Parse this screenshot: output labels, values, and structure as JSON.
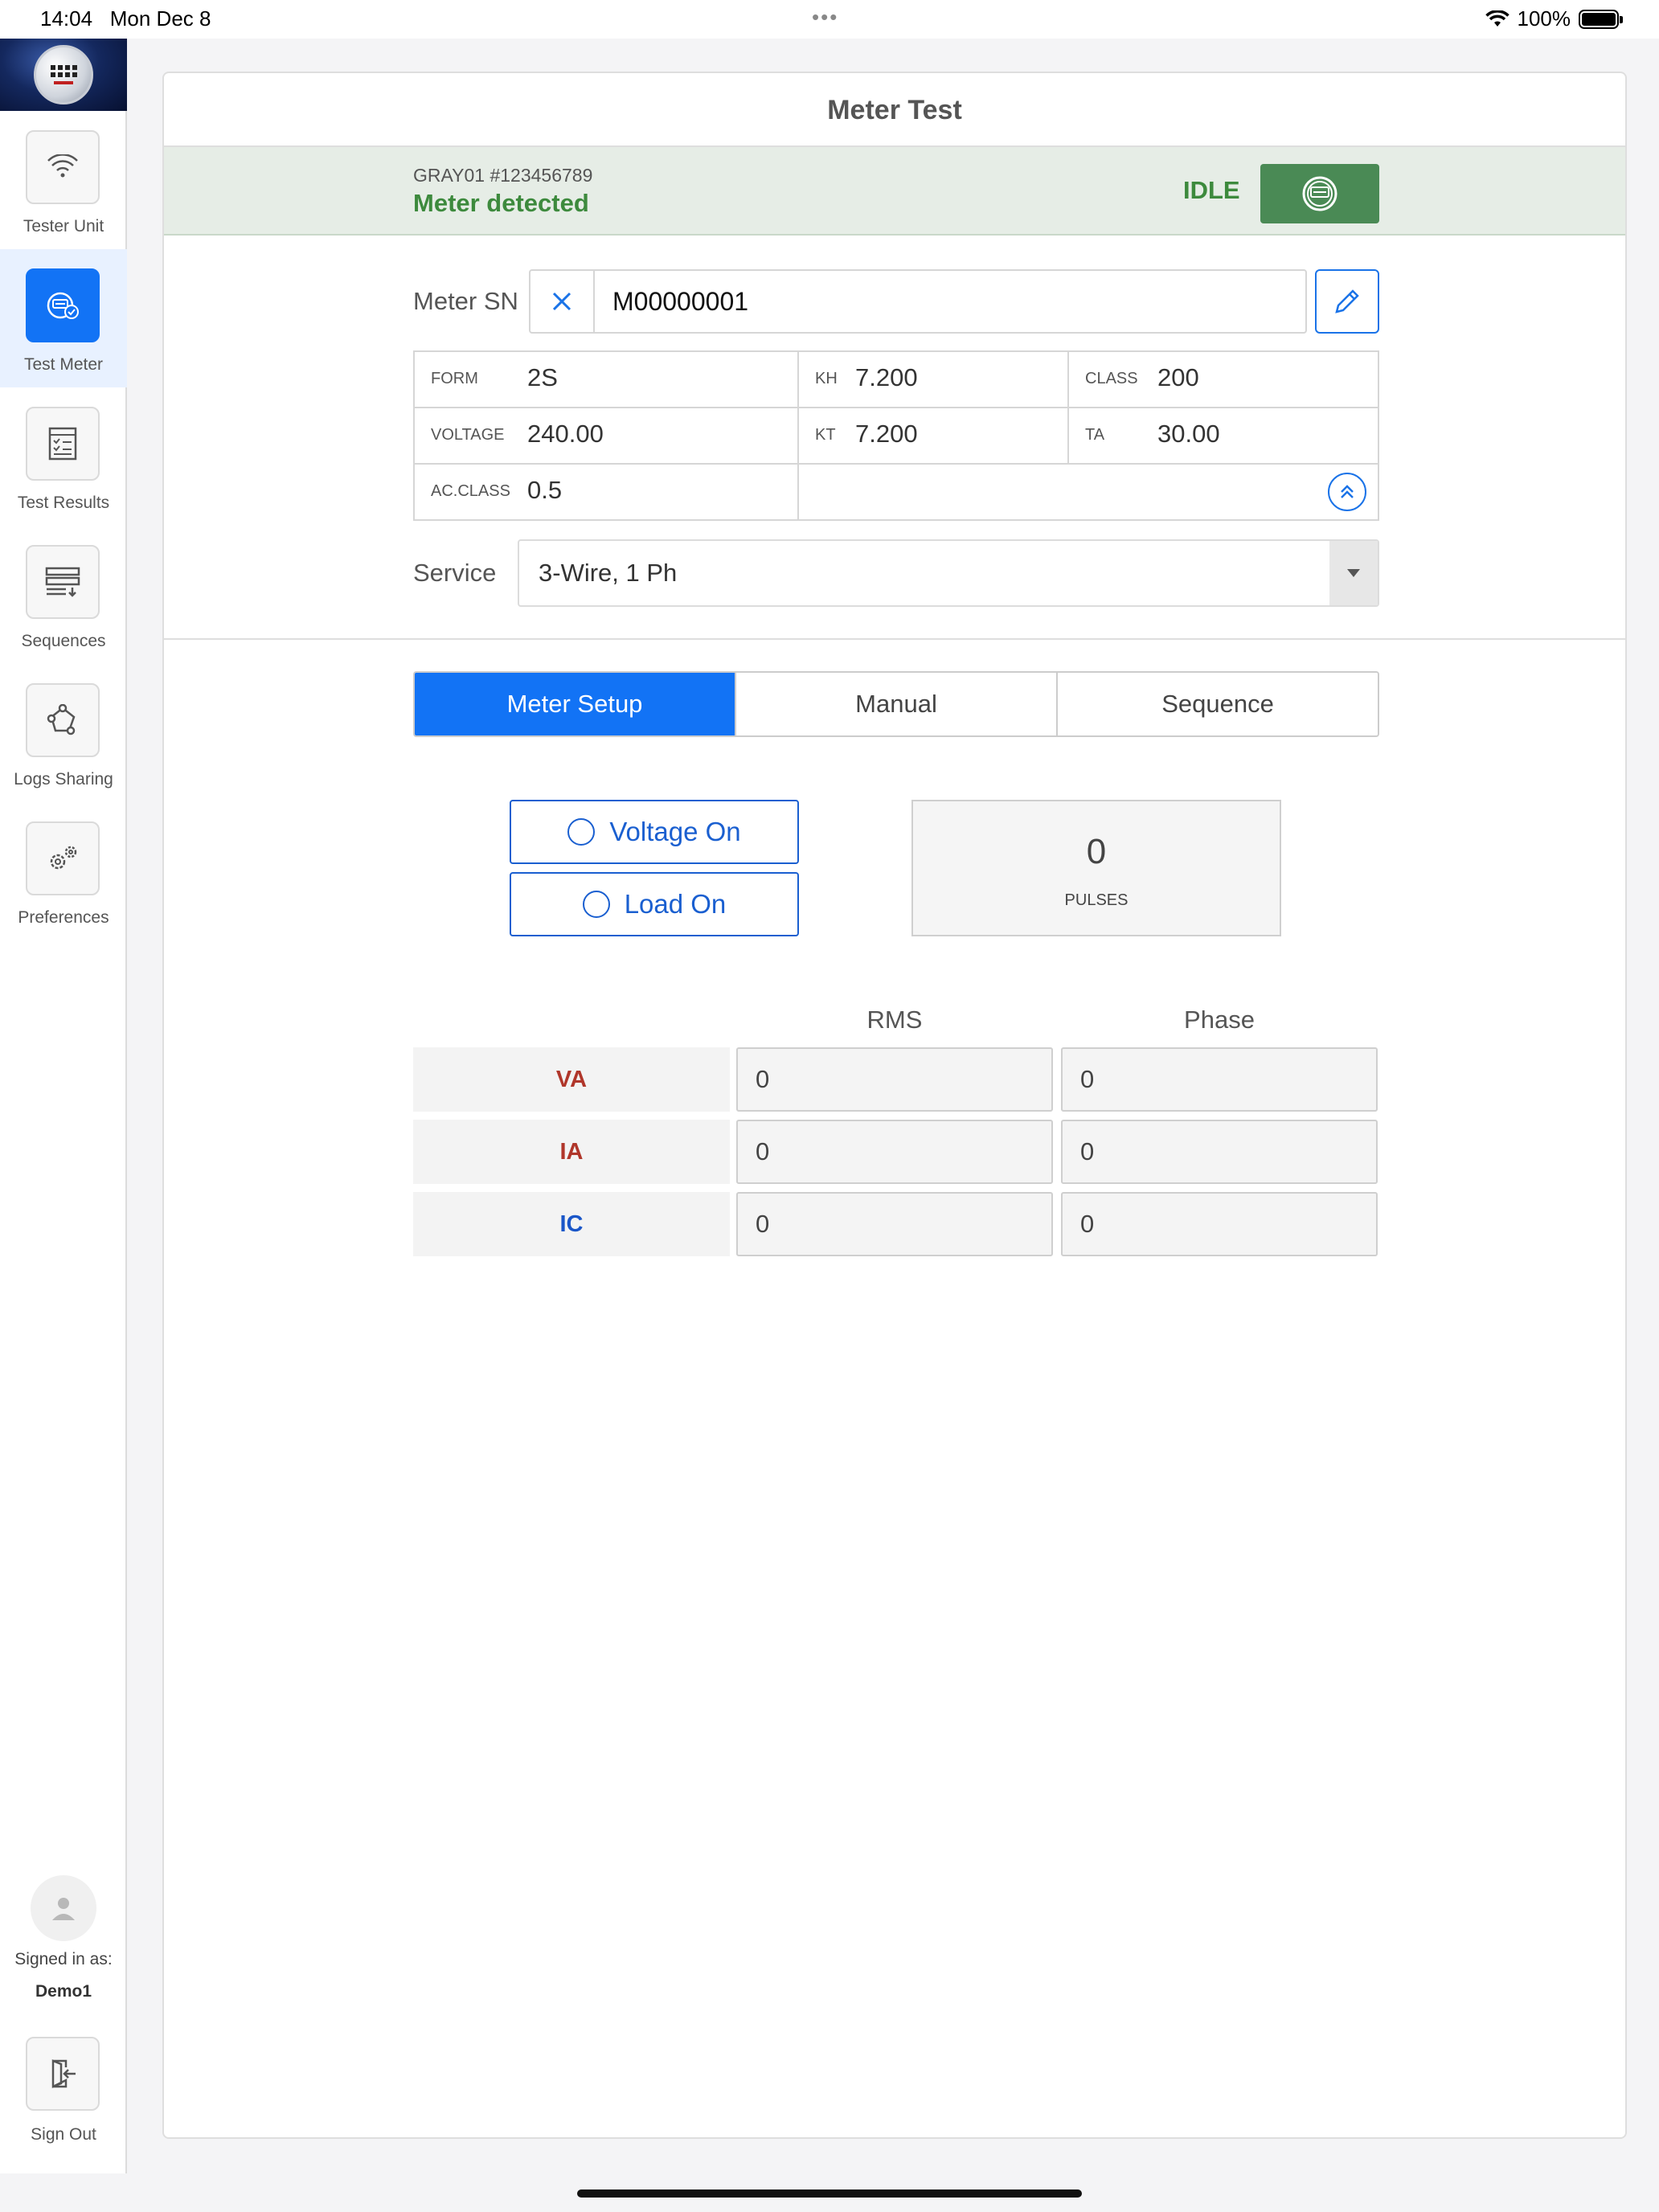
{
  "status_bar": {
    "time": "14:04",
    "date": "Mon Dec 8",
    "battery": "100%"
  },
  "sidebar": {
    "items": [
      {
        "label": "Tester Unit",
        "icon": "wifi-icon"
      },
      {
        "label": "Test Meter",
        "icon": "meter-check-icon",
        "active": true
      },
      {
        "label": "Test Results",
        "icon": "checklist-icon"
      },
      {
        "label": "Sequences",
        "icon": "sequence-list-icon"
      },
      {
        "label": "Logs Sharing",
        "icon": "share-icon"
      },
      {
        "label": "Preferences",
        "icon": "gears-icon"
      }
    ],
    "signed_in_label": "Signed in as:",
    "signed_in_user": "Demo1",
    "sign_out_label": "Sign Out"
  },
  "main": {
    "title": "Meter Test",
    "device_id": "GRAY01 #123456789",
    "device_status": "Meter detected",
    "run_state": "IDLE",
    "meter_sn_label": "Meter SN",
    "meter_sn_value": "M00000001",
    "details": {
      "form_key": "FORM",
      "form": "2S",
      "kh_key": "KH",
      "kh": "7.200",
      "class_key": "CLASS",
      "class": "200",
      "voltage_key": "VOLTAGE",
      "voltage": "240.00",
      "kt_key": "KT",
      "kt": "7.200",
      "ta_key": "TA",
      "ta": "30.00",
      "acclass_key": "AC.CLASS",
      "acclass": "0.5"
    },
    "service_label": "Service",
    "service_value": "3-Wire, 1 Ph",
    "tabs": [
      "Meter Setup",
      "Manual",
      "Sequence"
    ],
    "active_tab": "Meter Setup",
    "voltage_toggle": "Voltage On",
    "load_toggle": "Load On",
    "pulses_value": "0",
    "pulses_label": "PULSES",
    "table": {
      "col_rms": "RMS",
      "col_phase": "Phase",
      "rows": [
        {
          "label": "VA",
          "rms": "0",
          "phase": "0",
          "color": "#b0362a"
        },
        {
          "label": "IA",
          "rms": "0",
          "phase": "0",
          "color": "#b0362a"
        },
        {
          "label": "IC",
          "rms": "0",
          "phase": "0",
          "color": "#1a56c8"
        }
      ]
    }
  },
  "colors": {
    "accent": "#1273f5",
    "status_green": "#3d8a3d",
    "idle_button": "#4a8a55"
  }
}
